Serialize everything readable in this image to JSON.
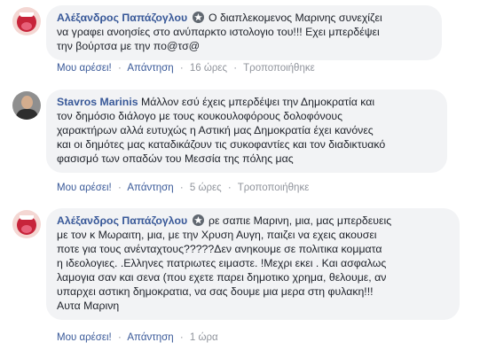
{
  "comments": [
    {
      "author": "Αλέξανδρος Παπάζογλου",
      "line1": " Ο διαπλεκομενος Μαρινης συνεχίζει",
      "line2": "να γραφει ανοησίες στο ανύπαρκτο ιστολογιο του!!! Εχει μπερδέψει",
      "line3": "την βούρτσα με την πο@τσ@",
      "like": "Μου αρέσει!",
      "reply": "Απάντηση",
      "time": "16 ώρες",
      "edited": "Τροποποιήθηκε"
    },
    {
      "author": "Stavros Marinis",
      "line1": " Μάλλον εσύ έχεις μπερδέψει την Δημοκρατία και",
      "line2": "τον δημόσιο διάλογο με τους κουκουλοφόρους δολοφόνους",
      "line3": "χαρακτήρων αλλά ευτυχώς η Αστική μας Δημοκρατία έχει κανόνες",
      "line4": "και οι δημότες μας καταδικάζουν τις συκοφαντίες και τον διαδικτυακό",
      "line5": "φασισμό των οπαδών του Μεσσία της πόλης μας",
      "like": "Μου αρέσει!",
      "reply": "Απάντηση",
      "time": "5 ώρες",
      "edited": "Τροποποιήθηκε"
    },
    {
      "author": "Αλέξανδρος Παπάζογλου",
      "line1": " ρε σαπιε Μαρινη, μια, μας μπερδευεις",
      "line2": "με τον κ Μωραιτη, μια, με την Χρυση Αυγη, παιζει να εχεις ακουσει",
      "line3": "ποτε για τους ανένταχτους?????Δεν ανηκουμε σε πολιτικα κομματα",
      "line4": "η ιδεολογιες. .Ελληνες πατριωτες ειμαστε. !Μεχρι εκει . Και ασφαλως",
      "line5": "λαμογια σαν και σενα (που εχετε παρει δημοτικο χρημα, θελουμε, αν",
      "line6": "υπαρχει αστικη δημοκρατια, να σας δουμε μια μερα στη φυλακη!!!",
      "line7": "Αυτα Μαρινη",
      "like": "Μου αρέσει!",
      "reply": "Απάντηση",
      "time": "1 ώρα"
    }
  ],
  "separator": "·",
  "colors": {
    "link": "#385898",
    "bubble": "#f2f3f5",
    "meta": "#90949c"
  },
  "icons": {
    "badge": "top-fan-badge-icon"
  }
}
